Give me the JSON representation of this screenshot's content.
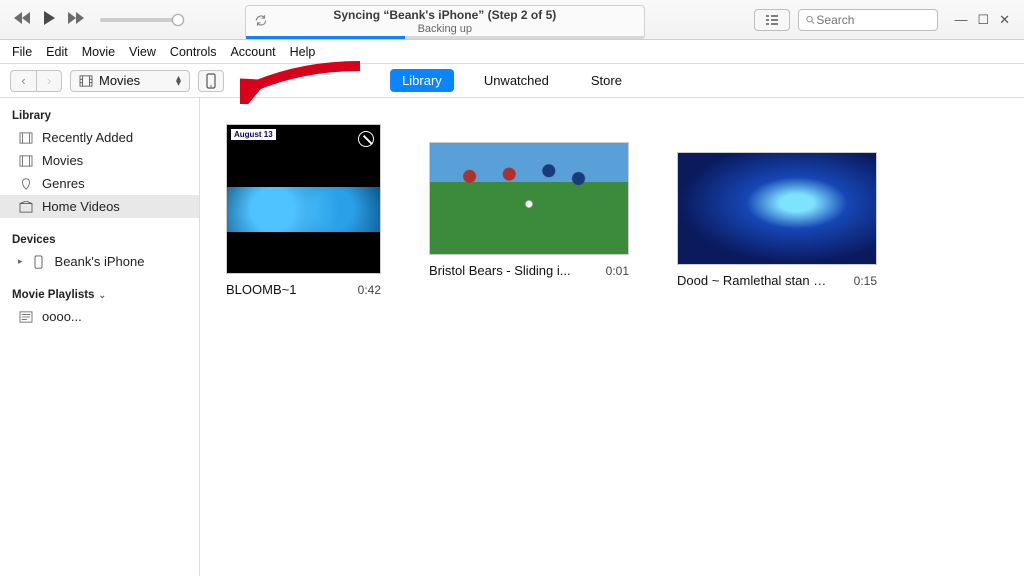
{
  "player": {
    "lcd_title": "Syncing “Beank's iPhone” (Step 2 of 5)",
    "lcd_subtitle": "Backing up",
    "search_placeholder": "Search"
  },
  "menu": {
    "file": "File",
    "edit": "Edit",
    "movie": "Movie",
    "view": "View",
    "controls": "Controls",
    "account": "Account",
    "help": "Help"
  },
  "toolbar": {
    "category": "Movies",
    "tabs": {
      "library": "Library",
      "unwatched": "Unwatched",
      "store": "Store"
    }
  },
  "sidebar": {
    "library_header": "Library",
    "library_items": [
      {
        "label": "Recently Added"
      },
      {
        "label": "Movies"
      },
      {
        "label": "Genres"
      },
      {
        "label": "Home Videos"
      }
    ],
    "devices_header": "Devices",
    "device_label": "Beank's iPhone",
    "playlists_header": "Movie Playlists",
    "playlist_label": "oooo..."
  },
  "videos": [
    {
      "title": "BLOOMB~1",
      "duration": "0:42",
      "badge": "August 13"
    },
    {
      "title": "Bristol Bears - Sliding i...",
      "duration": "0:01"
    },
    {
      "title": "Dood ~ Ramlethal stan acco...",
      "duration": "0:15"
    }
  ]
}
